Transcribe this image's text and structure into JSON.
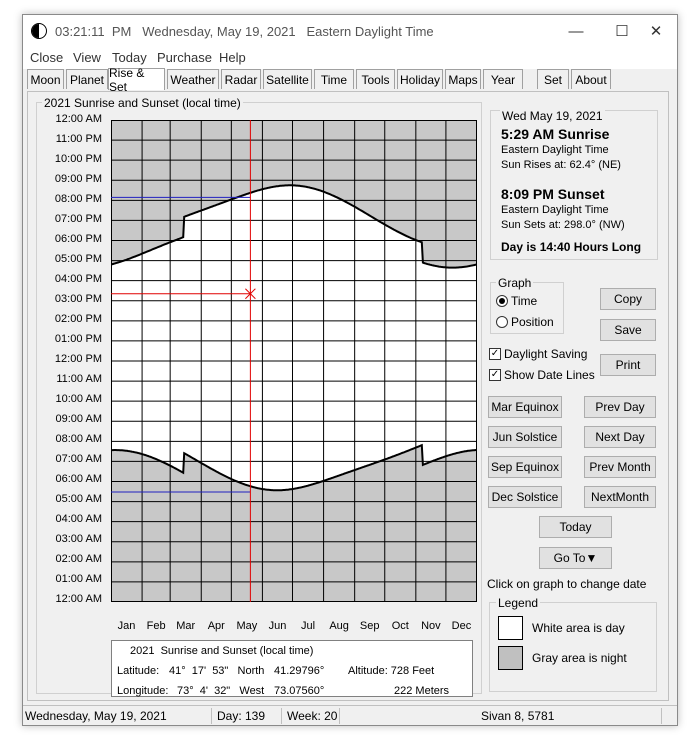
{
  "window": {
    "title": "03:21:11  PM   Wednesday, May 19, 2021   Eastern Daylight Time",
    "minimize": "—",
    "maximize": "☐",
    "close": "✕"
  },
  "menu": [
    "Close",
    "View",
    "Today",
    "Purchase",
    "Help"
  ],
  "tabs": [
    "Moon",
    "Planet",
    "Rise & Set",
    "Weather",
    "Radar",
    "Satellite",
    "Time",
    "Tools",
    "Holiday",
    "Maps",
    "Year",
    "Set",
    "About"
  ],
  "active_tab": "Rise & Set",
  "graph": {
    "group_title": "2021  Sunrise and Sunset (local time)",
    "y_labels": [
      "12:00 AM",
      "11:00 PM",
      "10:00 PM",
      "09:00 PM",
      "08:00 PM",
      "07:00 PM",
      "06:00 PM",
      "05:00 PM",
      "04:00 PM",
      "03:00 PM",
      "02:00 PM",
      "01:00 PM",
      "12:00 PM",
      "11:00 AM",
      "10:00 AM",
      "09:00 AM",
      "08:00 AM",
      "07:00 AM",
      "06:00 AM",
      "05:00 AM",
      "04:00 AM",
      "03:00 AM",
      "02:00 AM",
      "01:00 AM",
      "12:00 AM"
    ],
    "months": [
      "Jan",
      "Feb",
      "Mar",
      "Apr",
      "May",
      "Jun",
      "Jul",
      "Aug",
      "Sep",
      "Oct",
      "Nov",
      "Dec"
    ],
    "current_day_of_year": 139,
    "current_time_hours": 15.35,
    "sunrise_hours": 5.48,
    "sunset_hours": 20.15,
    "dst_start_day": 73,
    "dst_end_day": 311
  },
  "info": {
    "title": "2021  Sunrise and Sunset (local time)",
    "lat_label": "Latitude:",
    "lat_dms": "41°  17'  53\"   North",
    "lat_dec": "41.29796°",
    "alt_label": "Altitude: 728 Feet",
    "lon_label": "Longitude:",
    "lon_dms": "73°  4'  32\"   West",
    "lon_dec": "73.07560°",
    "alt_m": "222 Meters"
  },
  "details": {
    "date": "Wed  May 19, 2021",
    "sunrise": "5:29 AM Sunrise",
    "tz1": "Eastern Daylight Time",
    "rise_az": "Sun Rises at:  62.4° (NE)",
    "sunset": "8:09 PM Sunset",
    "tz2": "Eastern Daylight Time",
    "set_az": "Sun Sets at:  298.0° (NW)",
    "day_length": "Day is 14:40 Hours Long"
  },
  "graph_options": {
    "title": "Graph",
    "time": "Time",
    "position": "Position"
  },
  "buttons": {
    "copy": "Copy",
    "save": "Save",
    "print": "Print",
    "mar_equinox": "Mar Equinox",
    "prev_day": "Prev Day",
    "jun_solstice": "Jun Solstice",
    "next_day": "Next Day",
    "sep_equinox": "Sep Equinox",
    "prev_month": "Prev Month",
    "dec_solstice": "Dec Solstice",
    "next_month": "NextMonth",
    "today": "Today",
    "goto": "Go To▼"
  },
  "checks": {
    "daylight_saving": "Daylight Saving",
    "show_date_lines": "Show Date Lines"
  },
  "hint": "Click on graph to change date",
  "legend": {
    "title": "Legend",
    "day": "White area is day",
    "night": "Gray area is night"
  },
  "status": {
    "date": "Wednesday, May 19, 2021",
    "day": "Day: 139",
    "week": "Week: 20",
    "hebrew": "Sivan 8, 5781"
  },
  "colors": {
    "night": "#c8c8c8",
    "day": "#ffffff",
    "grid": "#000000",
    "marker": "#e00000",
    "sunline": "#2020c0"
  }
}
